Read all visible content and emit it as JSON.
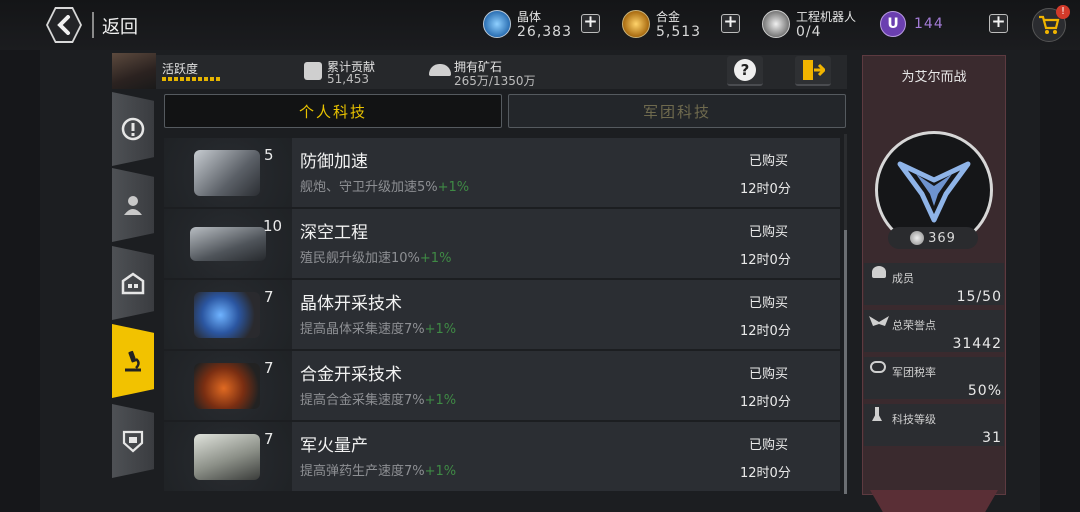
{
  "topbar": {
    "back_label": "返回",
    "resources": [
      {
        "name": "晶体",
        "value": "26,383",
        "icon": "crystal-icon",
        "color": "#4ea7e8"
      },
      {
        "name": "合金",
        "value": "5,513",
        "icon": "alloy-icon",
        "color": "#e8b84a"
      },
      {
        "name": "工程机器人",
        "value": "0/4",
        "icon": "robot-icon",
        "color": "#d8d8d8"
      },
      {
        "name": "U",
        "value": "144",
        "icon": "premium-currency-icon",
        "color": "#a37bd6"
      }
    ],
    "plus": "+",
    "cart_badge": "!"
  },
  "info": {
    "activity_label": "活跃度",
    "contribution_label": "累计贡献",
    "contribution_value": "51,453",
    "ore_label": "拥有矿石",
    "ore_value": "265万/1350万",
    "help": "?"
  },
  "tabs": {
    "personal": "个人科技",
    "legion": "军团科技"
  },
  "techs": [
    {
      "level": "5",
      "title": "防御加速",
      "desc": "舰炮、守卫升级加速5%",
      "bonus": "+1%",
      "status": "已购买",
      "time": "12时0分",
      "art": "#9aa0a6"
    },
    {
      "level": "10",
      "title": "深空工程",
      "desc": "殖民舰升级加速10%",
      "bonus": "+1%",
      "status": "已购买",
      "time": "12时0分",
      "art": "#8c9196"
    },
    {
      "level": "7",
      "title": "晶体开采技术",
      "desc": "提高晶体采集速度7%",
      "bonus": "+1%",
      "status": "已购买",
      "time": "12时0分",
      "art": "#3d6fb5"
    },
    {
      "level": "7",
      "title": "合金开采技术",
      "desc": "提高合金采集速度7%",
      "bonus": "+1%",
      "status": "已购买",
      "time": "12时0分",
      "art": "#c4531f"
    },
    {
      "level": "7",
      "title": "军火量产",
      "desc": "提高弹药生产速度7%",
      "bonus": "+1%",
      "status": "已购买",
      "time": "12时0分",
      "art": "#b7bab3"
    }
  ],
  "legion": {
    "name": "为艾尔而战",
    "emblem_count": "369",
    "stats": [
      {
        "label": "成员",
        "value": "15/50",
        "icon": "members-icon"
      },
      {
        "label": "总荣誉点",
        "value": "31442",
        "icon": "honor-icon"
      },
      {
        "label": "军团税率",
        "value": "50%",
        "icon": "tax-icon"
      },
      {
        "label": "科技等级",
        "value": "31",
        "icon": "microscope-icon"
      }
    ]
  }
}
